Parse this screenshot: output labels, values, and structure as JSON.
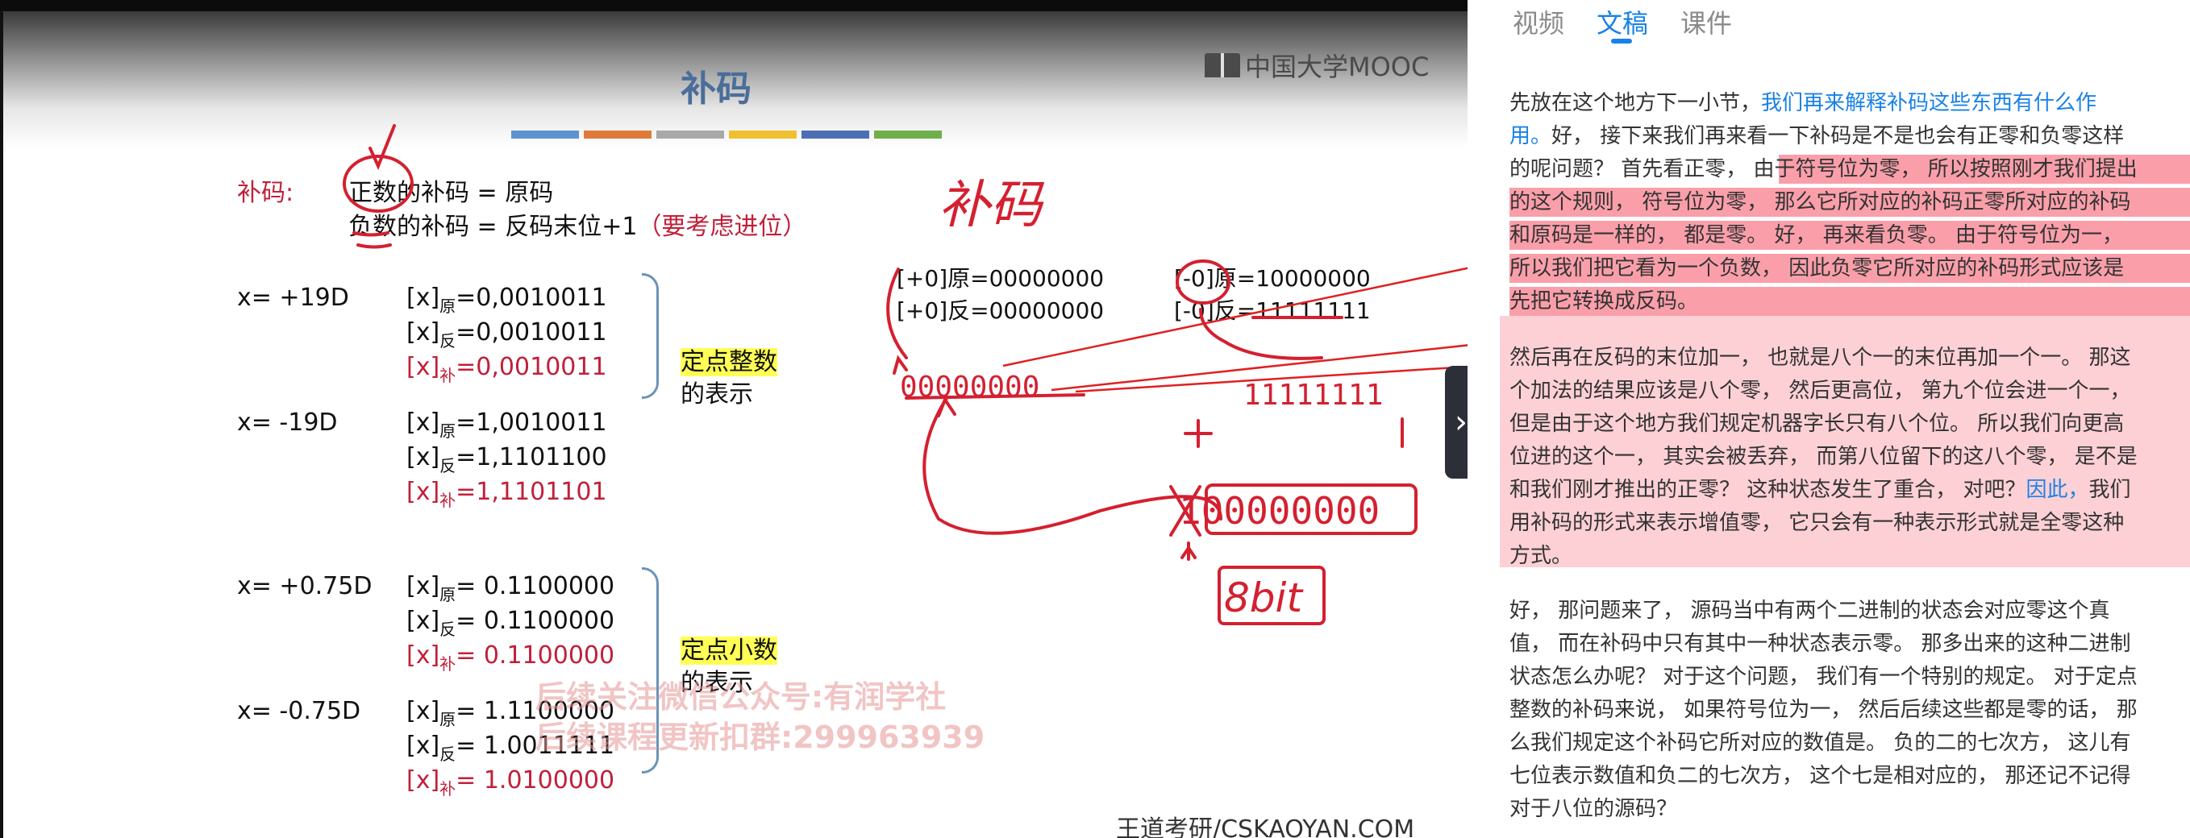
{
  "slide": {
    "title": "补码",
    "logo": "中国大学MOOC",
    "colorbar": [
      "#5f93cf",
      "#e07a3a",
      "#a8a8a8",
      "#f0c030",
      "#4a6fb5",
      "#6fb04a"
    ],
    "def_label": "补码:",
    "def_pos": "正数的补码 = 原码",
    "def_neg": "负数的补码 = 反码末位+1",
    "def_neg_note": "（要考虑进位）",
    "int_label_hl": "定点整数",
    "int_label_rest": "的表示",
    "frac_label_hl": "定点小数",
    "frac_label_rest": "的表示",
    "rows": [
      {
        "x": "x= +19D",
        "yuan": "=0,0010011",
        "fan": "=0,0010011",
        "bu": "=0,0010011"
      },
      {
        "x": "x= -19D",
        "yuan": "=1,0010011",
        "fan": "=1,1101100",
        "bu": "=1,1101101"
      },
      {
        "x": "x= +0.75D",
        "yuan": "= 0.1100000",
        "fan": "= 0.1100000",
        "bu": "= 0.1100000"
      },
      {
        "x": "x= -0.75D",
        "yuan": "= 1.1100000",
        "fan": "= 1.0011111",
        "bu": "= 1.0100000"
      }
    ],
    "x_bracket": "[x]",
    "sub_yuan": "原",
    "sub_fan": "反",
    "sub_bu": "补",
    "zero_pos_yuan": "[+0]原=00000000",
    "zero_pos_fan": "[+0]反=00000000",
    "zero_neg_yuan": "[-0]原=10000000",
    "zero_neg_fan": "[-0]反=11111111",
    "watermark_1": "后续关注微信公众号:有润学社",
    "watermark_2": "后续课程更新扣群:299963939",
    "footer": "王道考研/CSKAOYAN.COM",
    "handwriting": {
      "buma": "补码",
      "zeros": "00000000",
      "ones": "11111111",
      "plus": "+",
      "one": "1",
      "overflow": "100000000",
      "bits": "8bit"
    }
  },
  "sidebar": {
    "tabs": [
      "视频",
      "文稿",
      "课件"
    ],
    "active_tab": "文稿",
    "p1_a": "先放在这个地方下一小节，",
    "p1_link": "我们再来解释补码这些东西有什么作用。",
    "p1_b": "好， 接下来我们再来看一下补码是不是也会有正零和负零这样的呢问题？ 首先看正零， 由于符号位为零， 所以按照刚才我们提出的这个规则， 符号位为零， 那么它所对应的补码正零所对应的补码和原码是一样的， 都是零。 好， 再来看负零。 由于符号位为一， 所以我们把它看为一个负数， 因此负零它所对应的补码形式应该是先把它转换成反码。",
    "p2_a": "然后再在反码的末位加一， 也就是八个一的末位再加一个一。 那这个加法的结果应该是八个零， 然后更高位， 第九个位会进一个一， 但是由于这个地方我们规定机器字长只有八个位。 所以我们向更高位进的这个一， 其实会被丢弃， 而第八位留下的这八个零， 是不是和我们刚才推出的正零？ 这种状态发生了重合， 对吧？",
    "p2_link": "因此，",
    "p2_b": "我们用补码的形式来表示增值零， 它只会有一种表示形式就是全零这种方式。",
    "p3": "好， 那问题来了， 源码当中有两个二进制的状态会对应零这个真值， 而在补码中只有其中一种状态表示零。 那多出来的这种二进制状态怎么办呢？ 对于这个问题， 我们有一个特别的规定。 对于定点整数的补码来说， 如果符号位为一， 然后后续这些都是零的话， 那么我们规定这个补码它所对应的数值是。 负的二的七次方， 这儿有七位表示数值和负二的七次方， 这个七是相对应的， 那还记不记得对于八位的源码？"
  },
  "colors": {
    "accent_blue": "#1a82e6",
    "ink_red": "#d42030",
    "highlight_pink": "#f55064"
  }
}
